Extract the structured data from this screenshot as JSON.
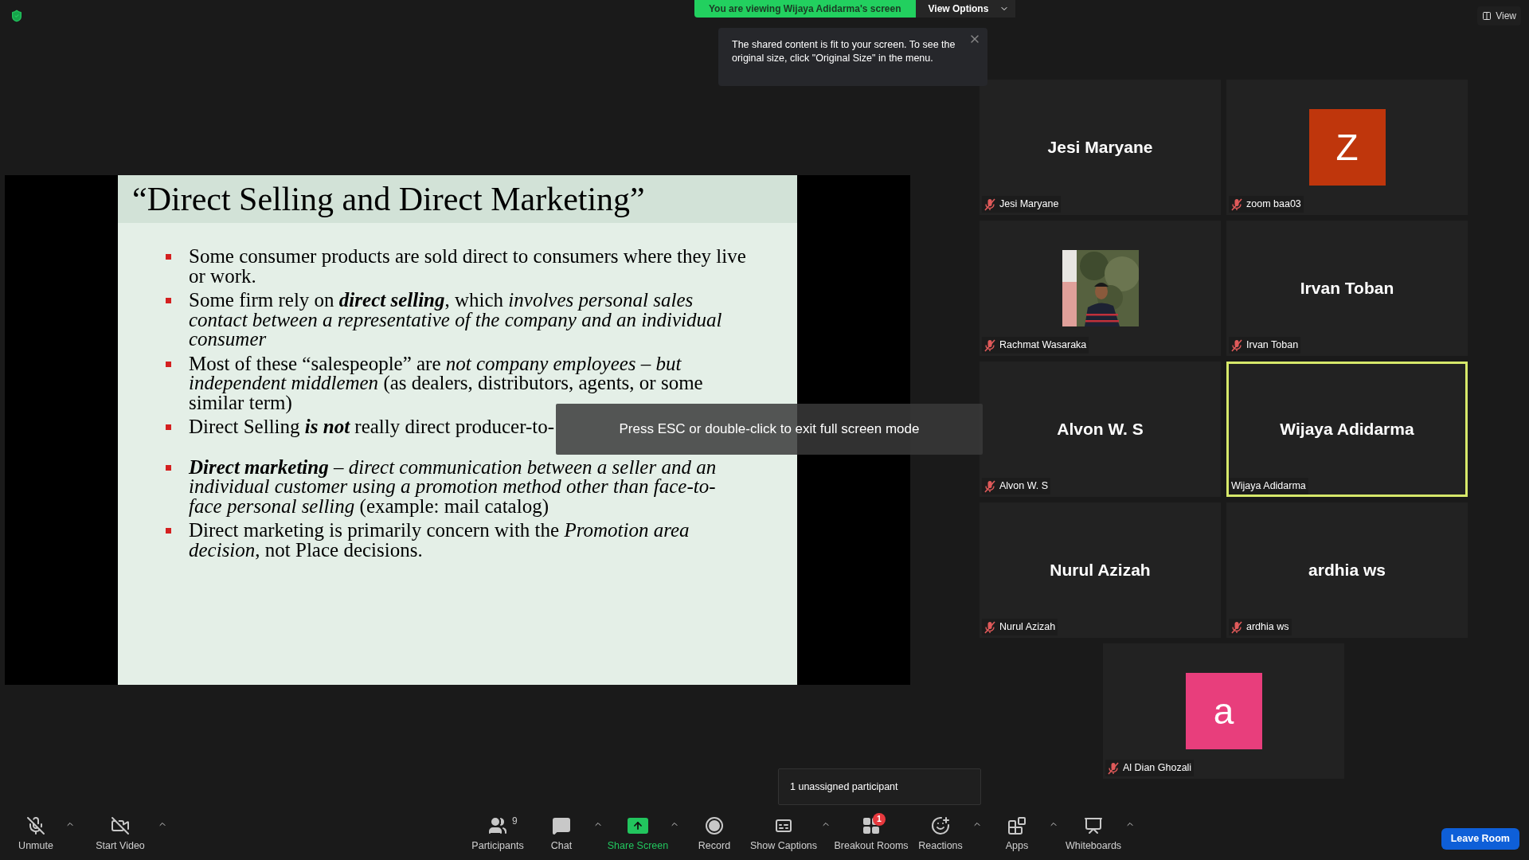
{
  "banner": {
    "text": "You are viewing Wijaya Adidarma's screen",
    "view_options": "View Options"
  },
  "fit_notice": {
    "text": "The shared content is fit to your screen. To see the original size, click \"Original Size\" in the menu."
  },
  "view_button": "View",
  "slide": {
    "title": "“Direct Selling and Direct Marketing”",
    "bullet_groups": [
      [
        "Some consumer products are sold direct to consumers where they live or work.",
        "Some firm rely on **direct selling**, which *involves personal sales contact between a representative of the company and an individual consumer*",
        "Most of these “salespeople” are *not company employees – but independent middlemen* (as dealers, distributors, agents, or some similar term)",
        "Direct Selling **is not** really direct producer-to-"
      ],
      [
        "**Direct marketing** – *direct communication between a seller and an individual customer using a promotion method other than face-to-face personal selling* (example: mail catalog)",
        "Direct marketing is primarily concern with the *Promotion area decision*, not Place decisions."
      ]
    ]
  },
  "fullscreen_hint": "Press ESC or double-click to exit full screen mode",
  "participants": [
    {
      "kind": "name",
      "name": "Jesi Maryane",
      "label": "Jesi Maryane",
      "muted": true,
      "speaking": false
    },
    {
      "kind": "avatar",
      "initial": "Z",
      "color": "#bf360c",
      "label": "zoom baa03",
      "muted": true,
      "speaking": false
    },
    {
      "label": "Rachmat Wasaraka",
      "muted": true,
      "speaking": false
    },
    {
      "kind": "name",
      "name": "Irvan Toban",
      "label": "Irvan Toban",
      "muted": true,
      "speaking": false
    },
    {
      "kind": "name",
      "name": "Alvon W. S",
      "label": "Alvon W. S",
      "muted": true,
      "speaking": false
    },
    {
      "kind": "name",
      "name": "Wijaya Adidarma",
      "label": "Wijaya Adidarma",
      "muted": false,
      "speaking": true
    },
    {
      "kind": "name",
      "name": "Nurul Azizah",
      "label": "Nurul Azizah",
      "muted": true,
      "speaking": false
    },
    {
      "kind": "name",
      "name": "ardhia ws",
      "label": "ardhia ws",
      "muted": true,
      "speaking": false
    },
    {
      "kind": "avatar",
      "initial": "a",
      "color": "#e83e7c",
      "label": "Al Dian Ghozali",
      "muted": true,
      "speaking": false
    }
  ],
  "breakout_tooltip": "1 unassigned participant",
  "toolbar": {
    "left": [
      {
        "kind": "mic",
        "label": "Unmute",
        "has_menu": true
      },
      {
        "kind": "video",
        "label": "Start Video",
        "has_menu": true
      }
    ],
    "center": [
      {
        "kind": "participants",
        "label": "Participants",
        "count": "9",
        "has_menu": false
      },
      {
        "kind": "chat",
        "label": "Chat",
        "has_menu": true
      },
      {
        "kind": "share",
        "label": "Share Screen",
        "has_menu": true
      },
      {
        "kind": "record",
        "label": "Record",
        "has_menu": false
      },
      {
        "kind": "captions",
        "label": "Show Captions",
        "has_menu": true
      },
      {
        "kind": "breakout",
        "label": "Breakout Rooms",
        "badge": "1",
        "has_menu": false
      },
      {
        "kind": "reactions",
        "label": "Reactions",
        "has_menu": true
      },
      {
        "kind": "apps",
        "label": "Apps",
        "has_menu": true
      },
      {
        "kind": "whiteboard",
        "label": "Whiteboards",
        "has_menu": true
      }
    ],
    "leave_button": "Leave Room"
  }
}
